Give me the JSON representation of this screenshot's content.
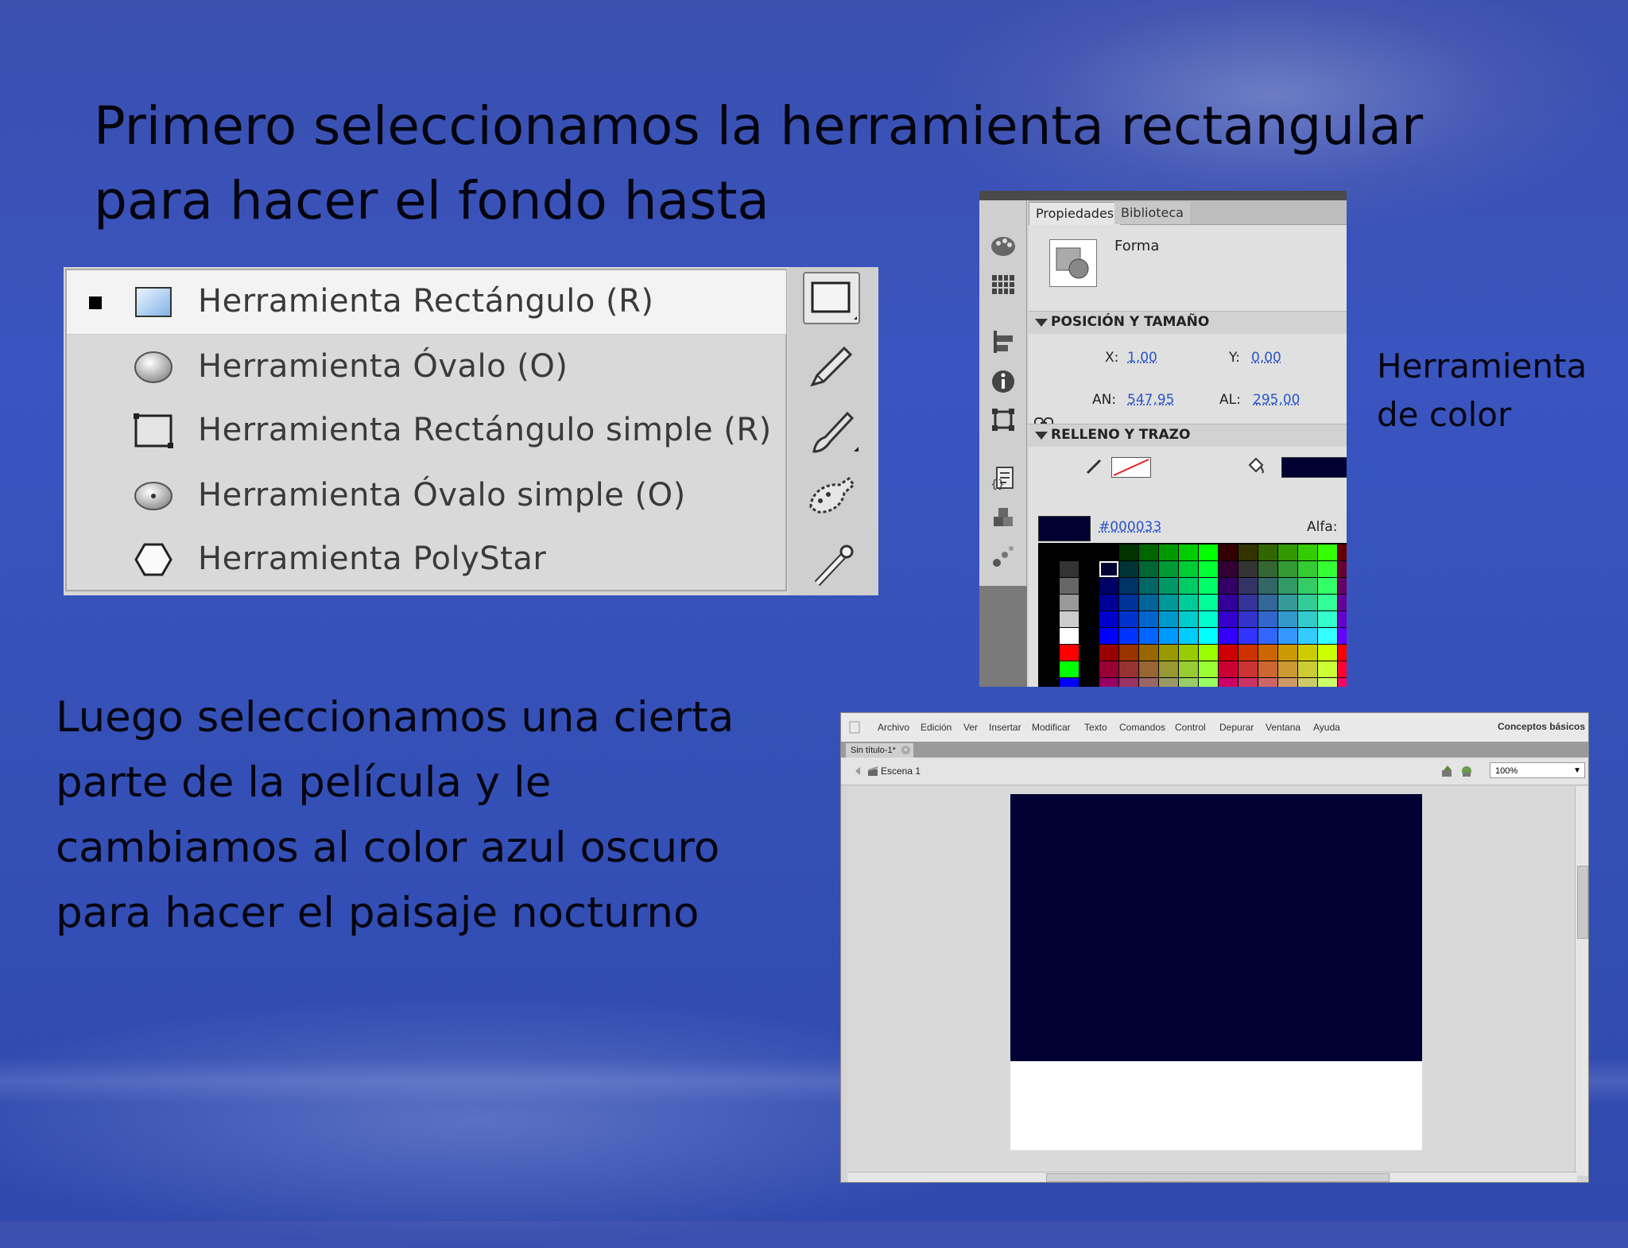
{
  "slide": {
    "title": "Primero seleccionamos la herramienta rectangular para hacer el fondo hasta",
    "body": "Luego seleccionamos una cierta parte de la película y le cambiamos al color azul oscuro para hacer el paisaje nocturno",
    "side_label": "Herramienta de color"
  },
  "tool_menu": {
    "items": [
      {
        "label": "Herramienta Rectángulo (R)",
        "icon": "rectangle-icon",
        "selected": true
      },
      {
        "label": "Herramienta Óvalo (O)",
        "icon": "oval-icon",
        "selected": false
      },
      {
        "label": "Herramienta Rectángulo simple (R)",
        "icon": "rectangle-primitive-icon",
        "selected": false
      },
      {
        "label": "Herramienta Óvalo simple (O)",
        "icon": "oval-primitive-icon",
        "selected": false
      },
      {
        "label": "Herramienta PolyStar",
        "icon": "polystar-icon",
        "selected": false
      }
    ],
    "toolbar_icons": [
      "rectangle-tool-icon",
      "pencil-tool-icon",
      "brush-tool-icon",
      "deco-tool-icon",
      "bone-tool-icon"
    ]
  },
  "properties_panel": {
    "tabs": [
      "Propiedades",
      "Biblioteca"
    ],
    "object_type": "Forma",
    "position_section": "POSICIÓN Y TAMAÑO",
    "x_label": "X:",
    "x_value": "1,00",
    "y_label": "Y:",
    "y_value": "0,00",
    "w_label": "AN:",
    "w_value": "547,95",
    "h_label": "AL:",
    "h_value": "295,00",
    "fill_section": "RELLENO Y TRAZO",
    "hex_value": "#000033",
    "alpha_label": "Alfa:",
    "fill_color": "#000033"
  },
  "flash_window": {
    "menu": [
      "Archivo",
      "Edición",
      "Ver",
      "Insertar",
      "Modificar",
      "Texto",
      "Comandos",
      "Control",
      "Depurar",
      "Ventana",
      "Ayuda"
    ],
    "workspace": "Conceptos básicos",
    "doc_tab": "Sin título-1*",
    "scene": "Escena 1",
    "zoom": "100%",
    "rect_color": "#000033"
  }
}
